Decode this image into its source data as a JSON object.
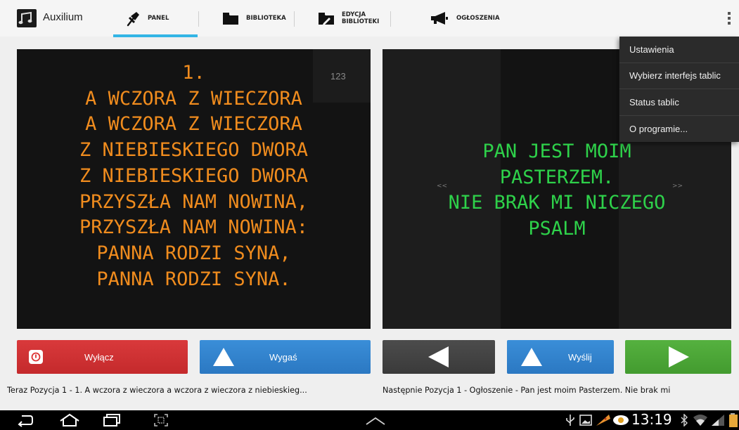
{
  "app": {
    "title": "Auxilium",
    "tabs": [
      {
        "label": "PANEL",
        "icon": "pin-icon",
        "selected": true
      },
      {
        "label": "BIBLIOTEKA",
        "icon": "folder-icon",
        "selected": false
      },
      {
        "label": "EDYCJA\nBIBLIOTEKI",
        "icon": "folder-edit-icon",
        "selected": false
      },
      {
        "label": "OGŁOSZENIA",
        "icon": "megaphone-icon",
        "selected": false
      }
    ],
    "accent_color": "#33b5e5"
  },
  "current_board": {
    "counter": "123",
    "text": "1.\nA WCZORA Z WIECZORA\nA WCZORA Z WIECZORA\nZ NIEBIESKIEGO DWORA\nZ NIEBIESKIEGO DWORA\nPRZYSZŁA NAM NOWINA,\nPRZYSZŁA NAM NOWINA:\nPANNA RODZI SYNA,\nPANNA RODZI SYNA.",
    "text_color": "#f08c1e"
  },
  "next_board": {
    "text": "PAN JEST MOIM\nPASTERZEM.\nNIE BRAK MI NICZEGO\nPSALM",
    "text_color": "#2ed14a",
    "prev_arrow": "<<",
    "next_arrow": ">>"
  },
  "buttons": {
    "off": "Wyłącz",
    "fade": "Wygaś",
    "send": "Wyślij"
  },
  "status": {
    "now": "Teraz  Pozycja 1 - 1. A wczora z wieczora a wczora z wieczora z niebieskieg...",
    "next": "Następnie  Pozycja 1 - Ogłoszenie - Pan jest moim Pasterzem. Nie brak mi"
  },
  "menu": {
    "items": [
      "Ustawienia",
      "Wybierz interfejs tablic",
      "Status tablic",
      "O programie..."
    ]
  },
  "system_bar": {
    "time": "13:19"
  }
}
